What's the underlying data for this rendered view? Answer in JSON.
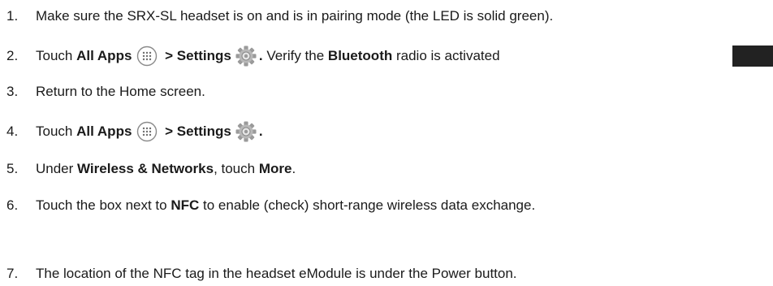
{
  "steps": [
    {
      "num": "1.",
      "parts": [
        "Make sure the SRX-SL headset is on and is in pairing mode (the LED is solid green)."
      ]
    },
    {
      "num": "2.",
      "touch": "Touch ",
      "all_apps": "All Apps",
      "gt": " > ",
      "settings": "Settings",
      "dot": ".",
      "verify": " Verify the ",
      "bluetooth": "Bluetooth",
      "rest": " radio is activated"
    },
    {
      "num": "3.",
      "parts": [
        "Return to the Home screen."
      ]
    },
    {
      "num": "4.",
      "touch": "Touch ",
      "all_apps": "All Apps",
      "gt": " > ",
      "settings": "Settings",
      "dot": "."
    },
    {
      "num": "5.",
      "under": "Under ",
      "wireless": "Wireless & Networks",
      "comma_touch": ", touch ",
      "more": "More",
      "period": "."
    },
    {
      "num": "6.",
      "pre": "Touch the box next to ",
      "nfc": "NFC",
      "post": " to enable (check) short-range wireless data exchange."
    },
    {
      "num": "7.",
      "parts": [
        "The location of the NFC tag in the headset eModule is under the Power button."
      ]
    }
  ],
  "icons": {
    "apps": "all-apps-icon",
    "settings": "settings-gear-icon"
  },
  "colors": {
    "text": "#1a1a1a",
    "icon_gray": "#8a8a8a",
    "toggle": "#222222"
  }
}
